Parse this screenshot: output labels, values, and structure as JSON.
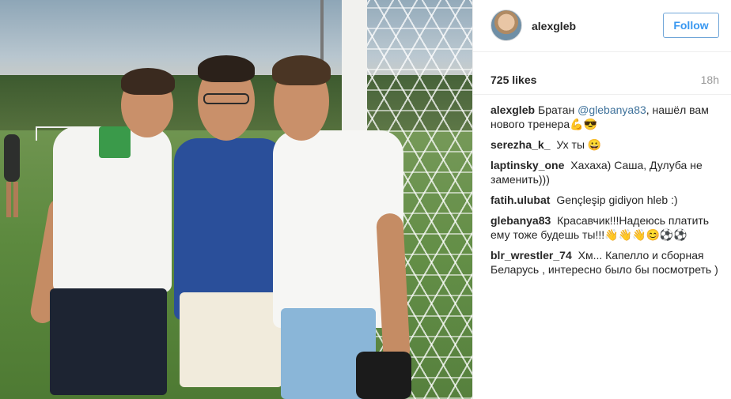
{
  "post": {
    "username": "alexgleb",
    "follow_label": "Follow",
    "likes": "725 likes",
    "time": "18h"
  },
  "comments": [
    {
      "user": "alexgleb",
      "pre": "Братан ",
      "mention": "@glebanya83",
      "post": ", нашёл вам нового тренера💪😎"
    },
    {
      "user": "serezha_k_",
      "text": "Ух ты 😀"
    },
    {
      "user": "laptinsky_one",
      "text": "Хахаха) Саша, Дулуба не заменить)))"
    },
    {
      "user": "fatih.ulubat",
      "text": "Gençleşip gidiyon hleb :)"
    },
    {
      "user": "glebanya83",
      "text": "Красавчик!!!Надеюсь платить ему тоже будешь ты!!!👋👋👋😊⚽⚽"
    },
    {
      "user": "blr_wrestler_74",
      "text": "Хм... Капелло и сборная Беларусь , интересно было бы посмотреть )"
    }
  ],
  "icons": {
    "avatar": "profile-photo"
  }
}
